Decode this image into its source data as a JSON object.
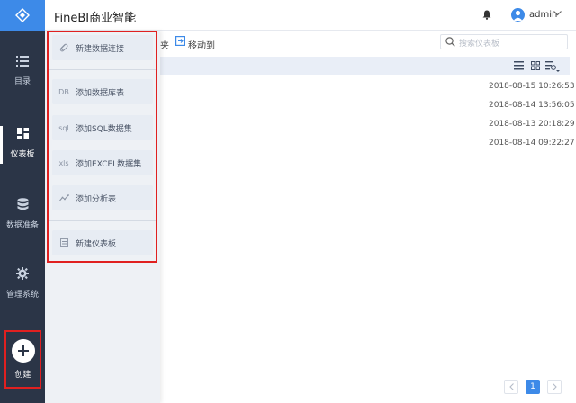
{
  "app": {
    "title": "FineBI商业智能"
  },
  "user": {
    "name": "admin"
  },
  "nav": {
    "items": [
      {
        "label": "目录"
      },
      {
        "label": "仪表板"
      },
      {
        "label": "数据准备"
      },
      {
        "label": "管理系统"
      }
    ],
    "create_label": "创建"
  },
  "toolbar": {
    "folder_fragment": "夹",
    "move_label": "移动到",
    "search_placeholder": "搜索仪表板"
  },
  "rows": [
    {
      "date": "2018-08-15 10:26:53"
    },
    {
      "date": "2018-08-14 13:56:05"
    },
    {
      "date": "2018-08-13 20:18:29"
    },
    {
      "date": "2018-08-14 09:22:27"
    }
  ],
  "create_menu": {
    "items": [
      {
        "icon": "link-icon",
        "label": "新建数据连接"
      },
      {
        "icon": "db-icon",
        "icon_text": "DB",
        "label": "添加数据库表"
      },
      {
        "icon": "sql-icon",
        "icon_text": "sql",
        "label": "添加SQL数据集"
      },
      {
        "icon": "excel-icon",
        "icon_text": "xls",
        "label": "添加EXCEL数据集"
      },
      {
        "icon": "analysis-icon",
        "label": "添加分析表"
      },
      {
        "icon": "dashboard-file-icon",
        "label": "新建仪表板"
      }
    ]
  },
  "pagination": {
    "current": "1"
  },
  "colors": {
    "nav_bg": "#2b3547",
    "accent": "#3d8ae8",
    "highlight": "#e02020"
  }
}
